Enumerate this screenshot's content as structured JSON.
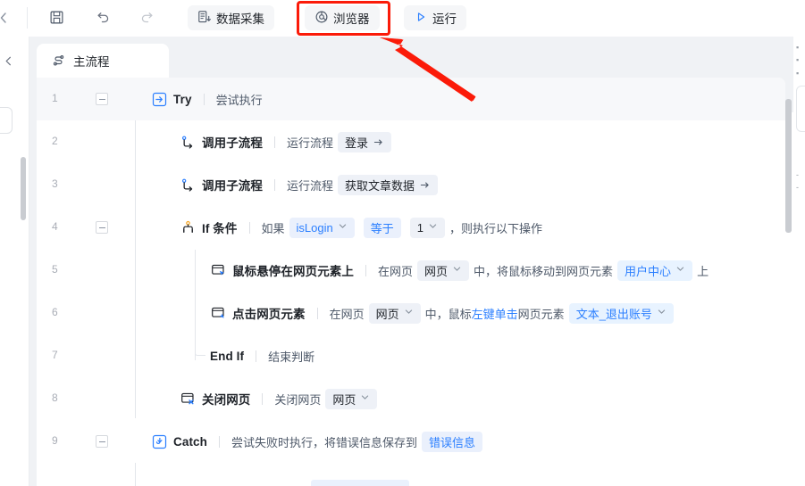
{
  "toolbar": {
    "collapse_left_icon": "chevron-left-icon",
    "save_icon": "save-floppy-icon",
    "undo_icon": "undo-arrow-icon",
    "redo_icon": "redo-arrow-icon",
    "data_collect_label": "数据采集",
    "data_collect_icon": "data-collect-icon",
    "browser_label": "浏览器",
    "browser_icon": "browser-globe-icon",
    "run_label": "运行",
    "run_icon": "play-triangle-icon"
  },
  "annotation": {
    "highlight_color": "#fb1b09",
    "target": "browser-button",
    "arrow_color": "#fb1b09"
  },
  "left_rail": {
    "collapse_icon": "chevron-left-icon"
  },
  "tabs": [
    {
      "label": "主流程",
      "icon": "flow-node-icon",
      "active": true
    }
  ],
  "flow": {
    "rows": [
      {
        "num": "1",
        "indent": 0,
        "collapsible": true,
        "highlight": true,
        "icon": "try-enter-icon",
        "icon_color": "#2b7fff",
        "name": "Try",
        "name_latin": true,
        "parts": [
          {
            "type": "text",
            "value": "尝试执行"
          }
        ]
      },
      {
        "num": "2",
        "indent": 1,
        "collapsible": false,
        "highlight": false,
        "icon": "call-subflow-icon",
        "icon_color": "#2b7fff",
        "name": "调用子流程",
        "parts": [
          {
            "type": "text",
            "value": "运行流程"
          },
          {
            "type": "chip",
            "value": "登录",
            "style": "plain",
            "suffix_icon": "enter-arrow-icon"
          }
        ]
      },
      {
        "num": "3",
        "indent": 1,
        "collapsible": false,
        "highlight": false,
        "icon": "call-subflow-icon",
        "icon_color": "#2b7fff",
        "name": "调用子流程",
        "parts": [
          {
            "type": "text",
            "value": "运行流程"
          },
          {
            "type": "chip",
            "value": "获取文章数据",
            "style": "plain",
            "suffix_icon": "enter-arrow-icon"
          }
        ]
      },
      {
        "num": "4",
        "indent": 1,
        "collapsible": true,
        "highlight": false,
        "icon": "if-condition-icon",
        "icon_color": "#f5a623",
        "name": "If 条件",
        "name_latin": true,
        "parts": [
          {
            "type": "text",
            "value": "如果"
          },
          {
            "type": "chip",
            "value": "isLogin",
            "style": "var",
            "suffix_icon": "chevron-down-icon"
          },
          {
            "type": "chip",
            "value": "等于",
            "style": "var",
            "suffix_icon": ""
          },
          {
            "type": "chip",
            "value": "1",
            "style": "plain",
            "suffix_icon": "chevron-down-icon"
          },
          {
            "type": "text",
            "value": "，则执行以下操作"
          }
        ]
      },
      {
        "num": "5",
        "indent": 2,
        "collapsible": false,
        "highlight": false,
        "icon": "web-element-hover-icon",
        "icon_color": "#2b7fff",
        "name": "鼠标悬停在网页元素上",
        "parts": [
          {
            "type": "text",
            "value": "在网页"
          },
          {
            "type": "chip",
            "value": "网页",
            "style": "plain",
            "suffix_icon": "chevron-down-icon"
          },
          {
            "type": "text",
            "value": "中，将鼠标移动到网页元素"
          },
          {
            "type": "chip",
            "value": "用户中心",
            "style": "varlt",
            "suffix_icon": "chevron-down-icon"
          },
          {
            "type": "text",
            "value": "上"
          }
        ]
      },
      {
        "num": "6",
        "indent": 2,
        "collapsible": false,
        "highlight": false,
        "icon": "web-element-click-icon",
        "icon_color": "#2b7fff",
        "name": "点击网页元素",
        "parts": [
          {
            "type": "text",
            "value": "在网页"
          },
          {
            "type": "chip",
            "value": "网页",
            "style": "plain",
            "suffix_icon": "chevron-down-icon"
          },
          {
            "type": "text",
            "value": "中，鼠标"
          },
          {
            "type": "link",
            "value": "左键单击"
          },
          {
            "type": "text",
            "value": "网页元素"
          },
          {
            "type": "chip",
            "value": "文本_退出账号",
            "style": "varlt",
            "suffix_icon": "chevron-down-icon"
          }
        ]
      },
      {
        "num": "7",
        "indent": 2,
        "collapsible": false,
        "highlight": false,
        "icon": "",
        "name": "End If",
        "name_latin": true,
        "parts": [
          {
            "type": "text",
            "value": "结束判断"
          }
        ]
      },
      {
        "num": "8",
        "indent": 1,
        "collapsible": false,
        "highlight": false,
        "icon": "close-webpage-icon",
        "icon_color": "#2b7fff",
        "name": "关闭网页",
        "parts": [
          {
            "type": "text",
            "value": "关闭网页"
          },
          {
            "type": "chip",
            "value": "网页",
            "style": "plain",
            "suffix_icon": "chevron-down-icon"
          }
        ]
      },
      {
        "num": "9",
        "indent": 0,
        "collapsible": true,
        "highlight": false,
        "icon": "catch-icon",
        "icon_color": "#2b7fff",
        "name": "Catch",
        "name_latin": true,
        "parts": [
          {
            "type": "text",
            "value": "尝试失败时执行，将错误信息保存到"
          },
          {
            "type": "chip",
            "value": "错误信息",
            "style": "var",
            "suffix_icon": ""
          }
        ]
      }
    ]
  }
}
